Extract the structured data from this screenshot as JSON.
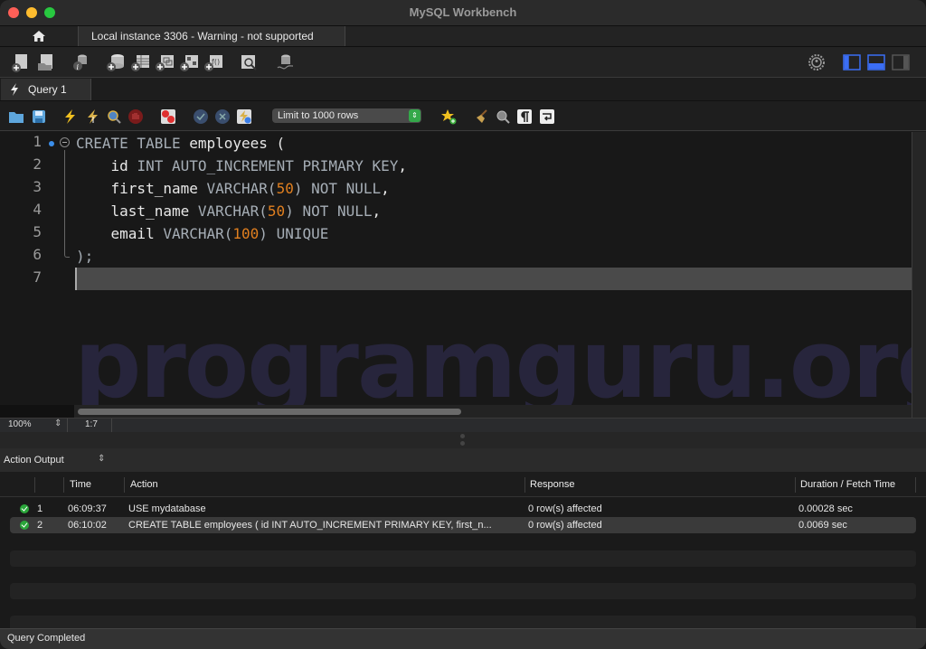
{
  "window": {
    "title": "MySQL Workbench"
  },
  "connection_tabs": {
    "home_icon": "home-icon",
    "active_tab": "Local instance 3306 - Warning - not supported"
  },
  "main_toolbar": {
    "icons": [
      "new-sql-tab-icon",
      "open-sql-script-icon",
      "schema-inspector-icon",
      "create-schema-icon",
      "create-table-icon",
      "create-view-icon",
      "create-procedure-icon",
      "create-function-icon",
      "search-table-data-icon",
      "reconnect-icon"
    ],
    "right_icons": [
      "settings-gear-icon",
      "toggle-sidebar-icon",
      "toggle-output-panel-icon",
      "toggle-secondary-sidebar-icon"
    ]
  },
  "query_tabs": [
    {
      "label": "Query 1",
      "icon": "lightning-icon"
    }
  ],
  "sql_toolbar": {
    "icons": [
      "open-file-icon",
      "save-icon",
      "execute-icon",
      "execute-current-icon",
      "explain-icon",
      "stop-icon",
      "toggle-error-continue-icon",
      "commit-icon",
      "rollback-icon",
      "autocommit-icon"
    ],
    "limit_select": "Limit to 1000 rows",
    "after_icons": [
      "add-snippet-icon",
      "beautify-icon",
      "find-icon",
      "invisible-chars-icon",
      "wrap-lines-icon"
    ]
  },
  "editor": {
    "line_numbers": [
      "1",
      "2",
      "3",
      "4",
      "5",
      "6",
      "7"
    ],
    "lines": [
      [
        {
          "t": "CREATE TABLE",
          "c": "kw"
        },
        {
          "t": " employees (",
          "c": ""
        }
      ],
      [
        {
          "t": "    id ",
          "c": ""
        },
        {
          "t": "INT AUTO_INCREMENT PRIMARY KEY",
          "c": "kw"
        },
        {
          "t": ",",
          "c": ""
        }
      ],
      [
        {
          "t": "    first_name ",
          "c": ""
        },
        {
          "t": "VARCHAR(",
          "c": "kw"
        },
        {
          "t": "50",
          "c": "num"
        },
        {
          "t": ") NOT NULL",
          "c": "kw"
        },
        {
          "t": ",",
          "c": ""
        }
      ],
      [
        {
          "t": "    last_name ",
          "c": ""
        },
        {
          "t": "VARCHAR(",
          "c": "kw"
        },
        {
          "t": "50",
          "c": "num"
        },
        {
          "t": ") NOT NULL",
          "c": "kw"
        },
        {
          "t": ",",
          "c": ""
        }
      ],
      [
        {
          "t": "    email ",
          "c": ""
        },
        {
          "t": "VARCHAR(",
          "c": "kw"
        },
        {
          "t": "100",
          "c": "num"
        },
        {
          "t": ") UNIQUE",
          "c": "kw"
        }
      ],
      [
        {
          "t": ");",
          "c": "kw"
        }
      ],
      [
        {
          "t": "",
          "c": ""
        }
      ]
    ],
    "watermark": "programguru.org"
  },
  "editor_status": {
    "zoom": "100%",
    "cursor": "1:7"
  },
  "output": {
    "selector": "Action Output",
    "columns": [
      "",
      "",
      "Time",
      "Action",
      "Response",
      "Duration / Fetch Time"
    ],
    "rows": [
      {
        "status": "success",
        "num": "1",
        "time": "06:09:37",
        "action": "USE mydatabase",
        "response": "0 row(s) affected",
        "duration": "0.00028 sec"
      },
      {
        "status": "success",
        "num": "2",
        "time": "06:10:02",
        "action": "CREATE TABLE employees (     id INT AUTO_INCREMENT PRIMARY KEY,     first_n...",
        "response": "0 row(s) affected",
        "duration": "0.0069 sec"
      }
    ]
  },
  "statusbar": {
    "text": "Query Completed"
  },
  "colors": {
    "keyword": "#a6aeb6",
    "number": "#e07f1f",
    "success": "#2aa63a",
    "accent": "#3b6ef5"
  }
}
